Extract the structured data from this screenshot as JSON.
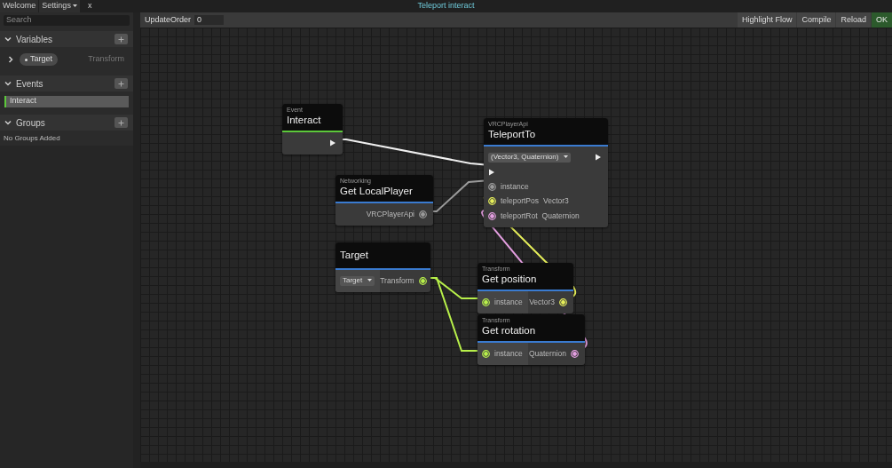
{
  "top_tabs": [
    {
      "label": "Welcome",
      "dropdown": false
    },
    {
      "label": "Settings",
      "dropdown": true
    }
  ],
  "close_label": "x",
  "window": {
    "title": "Teleport interact"
  },
  "sidebar": {
    "search": {
      "placeholder": "Search"
    },
    "sections": [
      {
        "title": "Variables",
        "expanded": true,
        "variables": [
          {
            "name": "Target",
            "type": "Transform",
            "expanded": false
          }
        ]
      },
      {
        "title": "Events",
        "expanded": true,
        "events": [
          {
            "label": "Interact"
          }
        ]
      },
      {
        "title": "Groups",
        "expanded": true,
        "empty_text": "No Groups Added"
      }
    ]
  },
  "toolbar": {
    "label": "UpdateOrder",
    "value": "0",
    "buttons": [
      {
        "label": "Highlight Flow",
        "highlighted": false
      },
      {
        "label": "Compile",
        "highlighted": false
      },
      {
        "label": "Reload",
        "highlighted": false
      },
      {
        "label": "OK",
        "highlighted": true
      }
    ]
  },
  "nodes": [
    {
      "category": "Event",
      "title": "Interact",
      "color": "#5cc83a",
      "rows": [
        {
          "right": {
            "kind": "flow"
          }
        }
      ]
    },
    {
      "category": "Networking",
      "title": "Get LocalPlayer",
      "color": "#3a7bd0",
      "rows": [
        {
          "right": {
            "kind": "data",
            "label": "VRCPlayerApi",
            "color": "#9a9a9a"
          }
        }
      ]
    },
    {
      "title": "Target",
      "color": "#3a7bd0",
      "rows": [
        {
          "left": {
            "kind": "dropdown",
            "label": "Target"
          },
          "right": {
            "kind": "data",
            "label": "Transform",
            "color": "#b8f04a"
          }
        }
      ]
    },
    {
      "category": "VRCPlayerApi",
      "title": "TeleportTo",
      "color": "#3a7bd0",
      "rows": [
        {
          "left": {
            "kind": "dropdown",
            "label": "(Vector3, Quaternion)"
          },
          "right": {
            "kind": "flow"
          }
        },
        {
          "left": {
            "kind": "flow"
          }
        },
        {
          "left": {
            "kind": "data",
            "label": "instance",
            "color": "#9a9a9a"
          }
        },
        {
          "left": {
            "kind": "data",
            "label": "teleportPos",
            "type": "Vector3",
            "color": "#e6ef5a"
          }
        },
        {
          "left": {
            "kind": "data",
            "label": "teleportRot",
            "type": "Quaternion",
            "color": "#e39ee0"
          }
        }
      ]
    },
    {
      "category": "Transform",
      "title": "Get position",
      "color": "#3a7bd0",
      "rows": [
        {
          "left": {
            "kind": "data",
            "label": "instance",
            "color": "#b8f04a"
          },
          "right": {
            "kind": "data",
            "label": "Vector3",
            "color": "#e6ef5a"
          }
        }
      ]
    },
    {
      "category": "Transform",
      "title": "Get rotation",
      "color": "#3a7bd0",
      "rows": [
        {
          "left": {
            "kind": "data",
            "label": "instance",
            "color": "#b8f04a"
          },
          "right": {
            "kind": "data",
            "label": "Quaternion",
            "color": "#e39ee0"
          }
        }
      ]
    }
  ]
}
